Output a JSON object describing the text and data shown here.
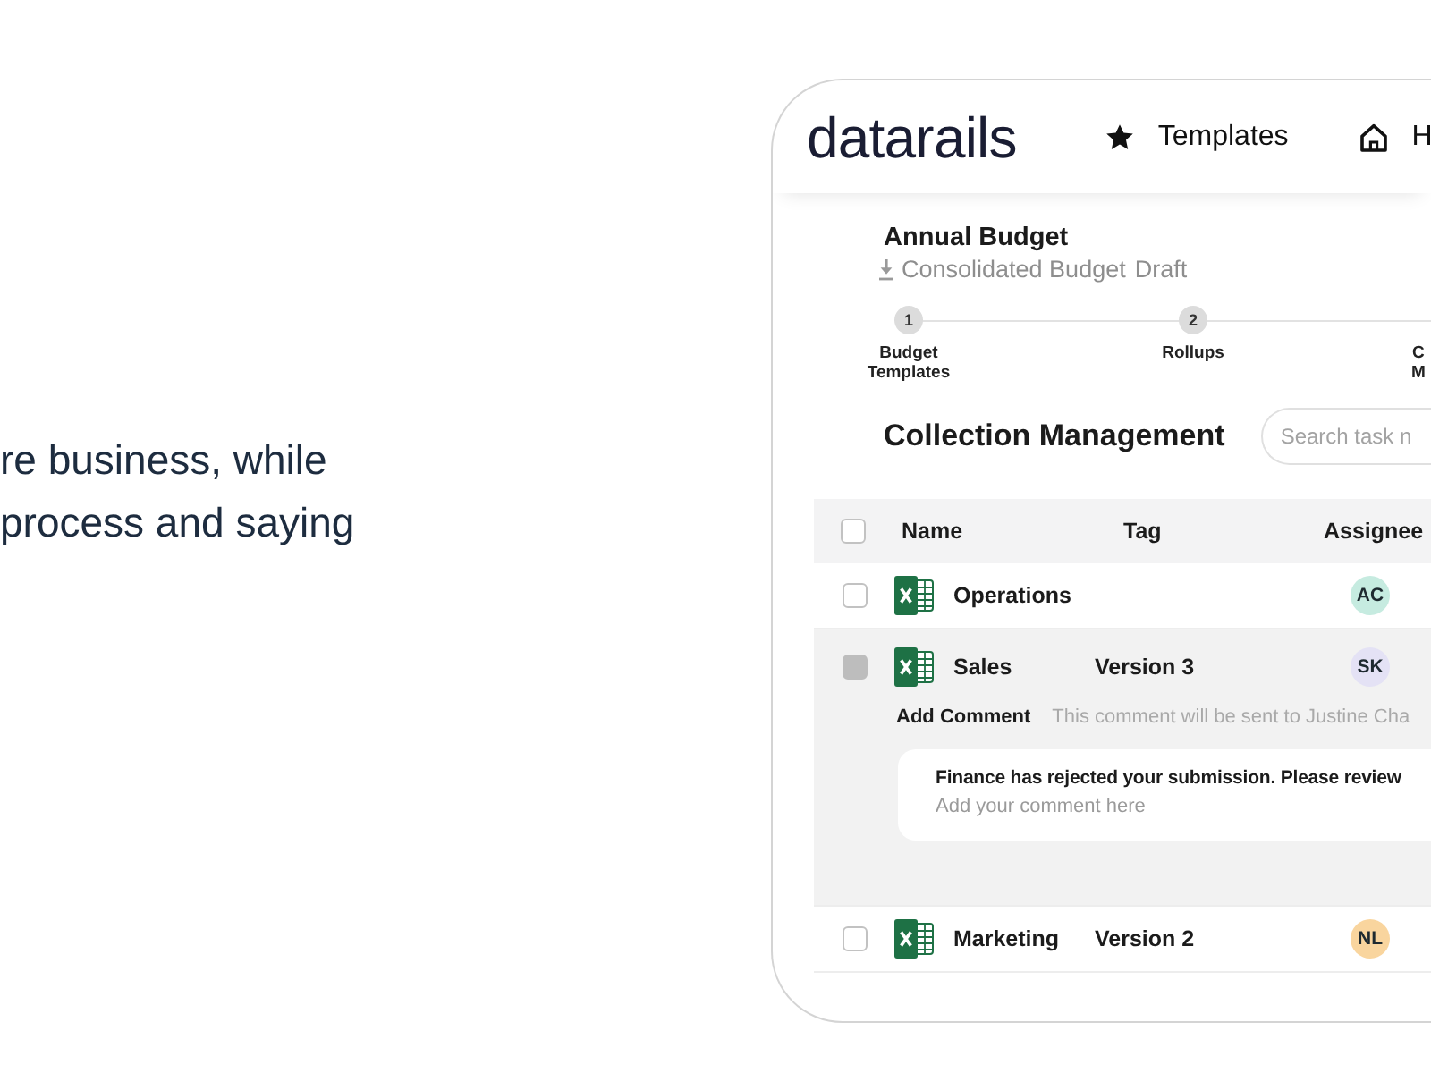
{
  "intro": {
    "text": "re business, while process and saying"
  },
  "header": {
    "logo": "datarails",
    "nav": [
      {
        "label": "Templates"
      },
      {
        "label": "H"
      }
    ]
  },
  "budget": {
    "title": "Annual Budget",
    "file": "Consolidated Budget",
    "status": "Draft"
  },
  "steps": [
    {
      "number": "1",
      "label": "Budget\nTemplates"
    },
    {
      "number": "2",
      "label": "Rollups"
    },
    {
      "label": "C\nM"
    }
  ],
  "collection": {
    "title": "Collection Management",
    "search": {
      "placeholder": "Search task n"
    }
  },
  "table": {
    "select_all_checked": false,
    "columns": [
      "Name",
      "Tag",
      "Assignee"
    ],
    "rows": [
      {
        "name": "Operations",
        "assignee": "AC",
        "color": "#c6ebe0",
        "checked": false,
        "expanded": false
      },
      {
        "name": "Sales",
        "tag": "Version 3",
        "assignee": "SK",
        "color": "#e4e2f5",
        "checked": true,
        "expanded": true,
        "comment": {
          "label": "Add Comment",
          "hint": "This comment will be sent to Justine Cha",
          "message": "Finance has rejected your submission. Please review",
          "placeholder": "Add your comment here"
        }
      },
      {
        "name": "Marketing",
        "tag": "Version 2",
        "assignee": "NL",
        "color": "#f9d59e",
        "checked": false,
        "expanded": false
      }
    ]
  }
}
